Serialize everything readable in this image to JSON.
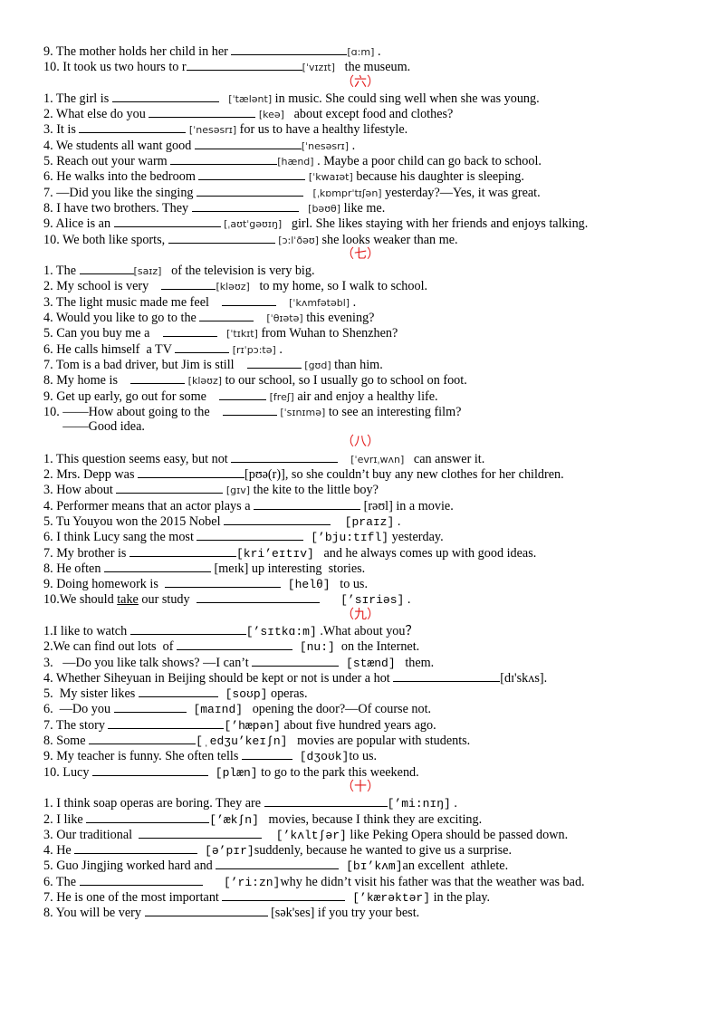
{
  "heading_color": "#e31d1d",
  "sections": [
    {
      "heading": "",
      "items": [
        {
          "pre": "9. The mother holds her child in her ",
          "blank": 128,
          "ipa": "[ɑ:m]",
          "post": " ."
        },
        {
          "pre": "10. It took us two hours to r",
          "blank": 128,
          "ipa": "[ˈvɪzɪt]",
          "post": "   the museum."
        }
      ]
    },
    {
      "heading": "（六）",
      "items": [
        {
          "pre": "1. The girl is ",
          "blank": 118,
          "ipa": "   [ˈtælənt]",
          "post": " in music. She could sing well when she was young."
        },
        {
          "pre": "2. What else do you ",
          "blank": 118,
          "ipa": " [keə]",
          "post": "   about except food and clothes?"
        },
        {
          "pre": "3. It is ",
          "blank": 118,
          "ipa": " [ˈnesəsrɪ]",
          "post": " for us to have a healthy lifestyle."
        },
        {
          "pre": "4. We students all want good ",
          "blank": 118,
          "ipa": "[ˈnesəsrɪ]",
          "post": " ."
        },
        {
          "pre": "5. Reach out your warm ",
          "blank": 118,
          "ipa": "[hænd]",
          "post": " . Maybe a poor child can go back to school."
        },
        {
          "pre": "6. He walks into the bedroom ",
          "blank": 118,
          "ipa": " [ˈkwaɪət]",
          "post": " because his daughter is sleeping."
        },
        {
          "pre": "7. —Did you like the singing ",
          "blank": 118,
          "ipa": "   [ˌkɒmprˈtɪʃən]",
          "post": " yesterday?—Yes, it was great."
        },
        {
          "pre": "8. I have two brothers. They ",
          "blank": 118,
          "ipa": "   [bəʊθ]",
          "post": " like me."
        },
        {
          "pre": "9. Alice is an ",
          "blank": 118,
          "ipa": " [ˌaʊtˈgəʊɪŋ]",
          "post": "   girl. She likes staying with her friends and enjoys talking."
        },
        {
          "pre": "10. We both like sports, ",
          "blank": 118,
          "ipa": " [ɔ:lˈðəʊ]",
          "post": " she looks weaker than me."
        }
      ]
    },
    {
      "heading": "（七）",
      "items": [
        {
          "pre": "1. The ",
          "blank": 60,
          "ipa": "[saɪz]",
          "post": "   of the television is very big."
        },
        {
          "pre": "2. My school is very    ",
          "blank": 60,
          "ipa": "[kləʊz]",
          "post": "   to my home, so I walk to school."
        },
        {
          "pre": "3. The light music made me feel    ",
          "blank": 60,
          "ipa": "    [ˈkʌmfətəbl]",
          "post": " ."
        },
        {
          "pre": "4. Would you like to go to the ",
          "blank": 60,
          "ipa": "    [ˈθɪətə]",
          "post": " this evening?"
        },
        {
          "pre": "5. Can you buy me a    ",
          "blank": 60,
          "ipa": "   [ˈtɪkɪt]",
          "post": " from Wuhan to Shenzhen?"
        },
        {
          "pre": "6. He calls himself  a TV ",
          "blank": 60,
          "ipa": " [rɪˈpɔ:tə]",
          "post": " ."
        },
        {
          "pre": "7. Tom is a bad driver, but Jim is still    ",
          "blank": 60,
          "ipa": " [gʊd]",
          "post": " than him."
        },
        {
          "pre": "8. My home is    ",
          "blank": 60,
          "ipa": " [kləʊz]",
          "post": " to our school, so I usually go to school on foot."
        },
        {
          "pre": "9. Get up early, go out for some    ",
          "blank": 52,
          "ipa": " [freʃ]",
          "post": " air and enjoy a healthy life."
        },
        {
          "pre": "10. ——How about going to the    ",
          "blank": 60,
          "ipa": " [ˈsɪnɪmə]",
          "post": " to see an interesting film?"
        },
        {
          "pre": "      ——Good idea.",
          "blank": 0,
          "ipa": "",
          "post": ""
        }
      ]
    },
    {
      "heading": "（八）",
      "items": [
        {
          "pre": "1. This question seems easy, but not ",
          "blank": 118,
          "ipa": "    [ˈevrɪˌwʌn]",
          "post": "   can answer it."
        },
        {
          "pre": "2. Mrs. Depp was ",
          "blank": 118,
          "ipa": "",
          "post": "[pʊə(r)], so she couldn’t buy any new clothes for her children."
        },
        {
          "pre": "3. How about ",
          "blank": 118,
          "ipa": " [gɪv]",
          "post": " the kite to the little boy?"
        },
        {
          "pre": "4. Performer means that an actor plays a ",
          "blank": 118,
          "ipa": "",
          "post": " [rəʊl] in a movie."
        },
        {
          "pre": "5. Tu Youyou won the 2015 Nobel ",
          "blank": 118,
          "mono": "  [praɪz]",
          "post": " ."
        },
        {
          "pre": "6. I think Lucy sang the most ",
          "blank": 118,
          "mono": " [’bju:tɪfl]",
          "post": " yesterday."
        },
        {
          "pre": "7. My brother is ",
          "blank": 118,
          "mono": "[kri’eɪtɪv]",
          "post": "   and he always comes up with good ideas."
        },
        {
          "pre": "8. He often ",
          "blank": 118,
          "ipa": "",
          "post": " [meɪk] up interesting  stories."
        },
        {
          "pre": "9. Doing homework is  ",
          "blank": 128,
          "mono": " [helθ]",
          "post": "   to us."
        },
        {
          "pre": "10.We should ",
          "ul": "take",
          "pre2": " our study  ",
          "blank": 136,
          "mono": "   [’sɪriəs]",
          "post": " ."
        }
      ]
    },
    {
      "heading": "（九）",
      "items": [
        {
          "pre": "1.I like to watch ",
          "blank": 128,
          "mono": "[’sɪtkɑ:m]",
          "post": " .What about you？"
        },
        {
          "pre": "2.We can find out lots  of ",
          "blank": 128,
          "mono": " [nu:]",
          "post": "  on the Internet."
        },
        {
          "pre": "3.   —Do you like talk shows? —I can’t ",
          "blank": 96,
          "mono": " [stænd]",
          "post": "   them."
        },
        {
          "pre": "4. Whether Siheyuan in Beijing should be kept or not is under a hot ",
          "blank": 118,
          "ipa": "",
          "post": "[dɪ'skʌs]."
        },
        {
          "pre": "5.  My sister likes ",
          "blank": 88,
          "mono": " [soʊp]",
          "post": " operas."
        },
        {
          "pre": "6.  —Do you ",
          "blank": 80,
          "mono": " [maɪnd]",
          "post": "   opening the door?—Of course not."
        },
        {
          "pre": "7. The story ",
          "blank": 128,
          "mono": "[’hæpən]",
          "post": " about five hundred years ago."
        },
        {
          "pre": "8. Some ",
          "blank": 118,
          "mono": "[ˌedʒu’keɪʃn]",
          "post": "   movies are popular with students."
        },
        {
          "pre": "9. My teacher is funny. She often tells ",
          "blank": 56,
          "mono": " [dʒoʊk]",
          "post": "to us."
        },
        {
          "pre": "10. Lucy ",
          "blank": 128,
          "mono": " [plæn]",
          "post": " to go to the park this weekend."
        }
      ]
    },
    {
      "heading": "（十）",
      "items": [
        {
          "pre": "1. I think soap operas are boring. They are ",
          "blank": 136,
          "mono": "[’mi:nɪŋ]",
          "post": " ."
        },
        {
          "pre": "2. I like ",
          "blank": 136,
          "mono": "[’ækʃn]",
          "post": "   movies, because I think they are exciting."
        },
        {
          "pre": "3. Our traditional  ",
          "blank": 136,
          "mono": "  [’kʌltʃər]",
          "post": " like Peking Opera should be passed down."
        },
        {
          "pre": "4. He ",
          "blank": 136,
          "mono": " [ə’pɪr]",
          "post": "suddenly, because he wanted to give us a surprise."
        },
        {
          "pre": "5. Guo Jingjing worked hard and ",
          "blank": 136,
          "mono": " [bɪ’kʌm]",
          "post": "an excellent  athlete."
        },
        {
          "pre": "6. The ",
          "blank": 136,
          "mono": "   [’ri:zn]",
          "post": "why he didn’t visit his father was that the weather was bad."
        },
        {
          "pre": "7. He is one of the most important ",
          "blank": 136,
          "mono": " [’kærəktər]",
          "post": " in the play."
        },
        {
          "pre": "8. You will be very ",
          "blank": 136,
          "ipa": "",
          "post": " [sək'ses] if you try your best."
        }
      ]
    }
  ]
}
